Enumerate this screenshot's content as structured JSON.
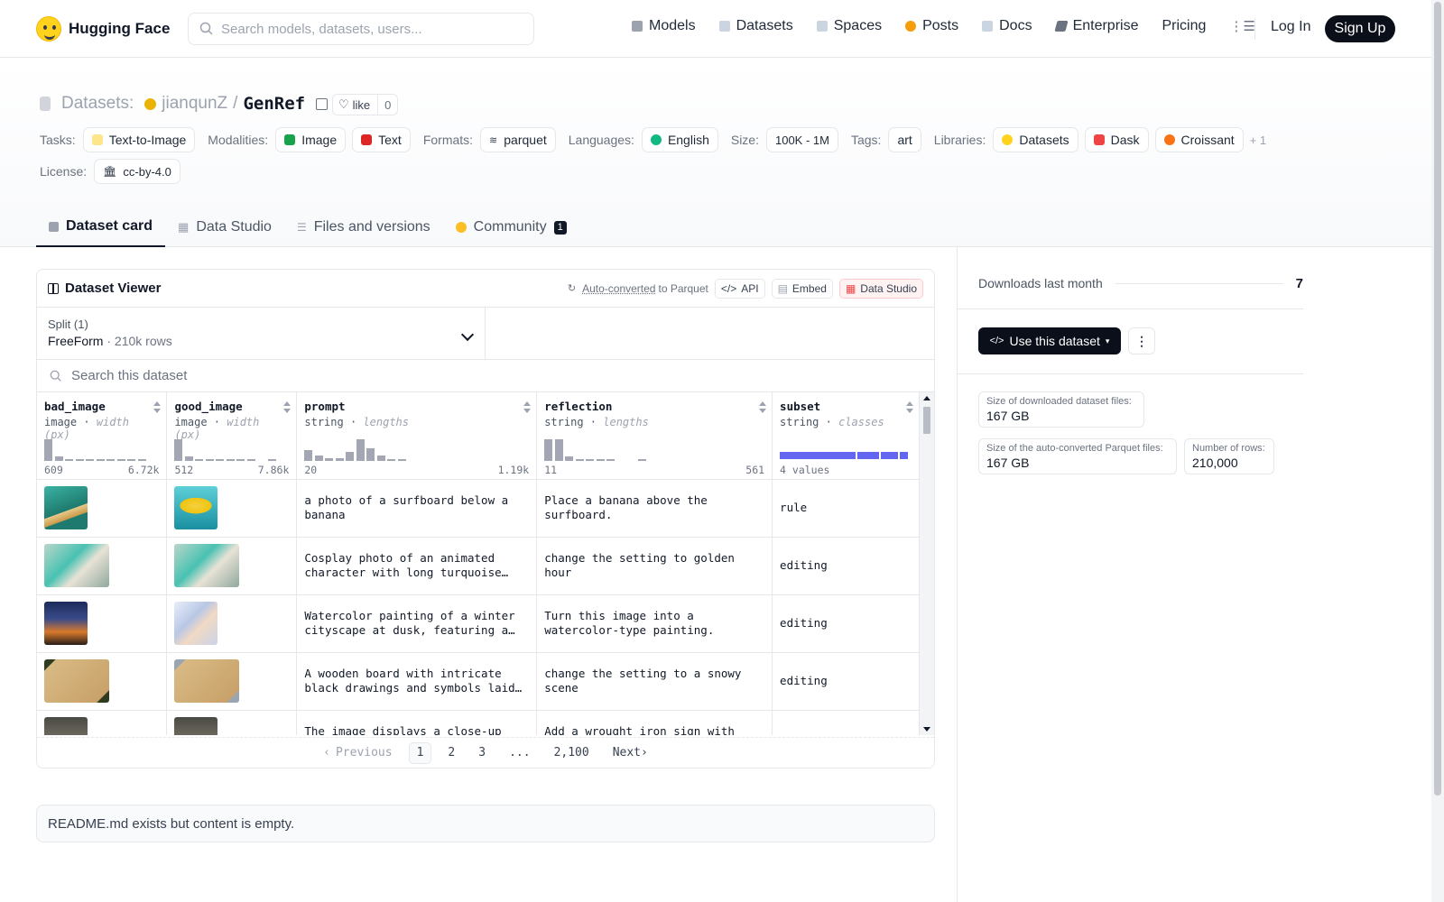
{
  "nav": {
    "logo_text": "Hugging Face",
    "search_placeholder": "Search models, datasets, users...",
    "links": [
      {
        "label": "Models",
        "color": "#6b7280"
      },
      {
        "label": "Datasets",
        "color": "#9ca3af"
      },
      {
        "label": "Spaces",
        "color": "#9ca3af"
      },
      {
        "label": "Posts",
        "color": "#f59e0b"
      },
      {
        "label": "Docs",
        "color": "#9ca3af"
      },
      {
        "label": "Enterprise",
        "color": "#6b7280"
      }
    ],
    "pricing": "Pricing",
    "login": "Log In",
    "signup": "Sign Up"
  },
  "repo": {
    "section": "Datasets:",
    "owner": "jianqunZ",
    "separator": "/",
    "name": "GenRef",
    "like_label": "like",
    "like_count": "0"
  },
  "tags": {
    "tasks_label": "Tasks:",
    "task": "Text-to-Image",
    "modalities_label": "Modalities:",
    "modalities": [
      "Image",
      "Text"
    ],
    "formats_label": "Formats:",
    "format": "parquet",
    "languages_label": "Languages:",
    "language": "English",
    "size_label": "Size:",
    "size": "100K - 1M",
    "tags_label": "Tags:",
    "tag": "art",
    "libraries_label": "Libraries:",
    "libraries": [
      "Datasets",
      "Dask",
      "Croissant"
    ],
    "libraries_more": "+ 1",
    "license_label": "License:",
    "license": "cc-by-4.0"
  },
  "tabs": [
    {
      "label": "Dataset card",
      "active": true
    },
    {
      "label": "Data Studio"
    },
    {
      "label": "Files and versions"
    },
    {
      "label": "Community",
      "badge": "1"
    }
  ],
  "viewer": {
    "title": "Dataset Viewer",
    "auto_converted": "Auto-converted",
    "to_parquet": "to Parquet",
    "api": "API",
    "embed": "Embed",
    "data_studio": "Data Studio",
    "split_label": "Split (1)",
    "split_name": "FreeForm",
    "split_rows": "210k rows",
    "search_placeholder": "Search this dataset",
    "columns": [
      {
        "name": "bad_image",
        "type": "image",
        "stat": "width (px)",
        "min": "609",
        "max": "6.72k",
        "hist": [
          0.85,
          0.15,
          0.05,
          0.05,
          0.05,
          0.05,
          0.05,
          0.05,
          0.05,
          0.05
        ]
      },
      {
        "name": "good_image",
        "type": "image",
        "stat": "width (px)",
        "min": "512",
        "max": "7.86k",
        "hist": [
          0.85,
          0.15,
          0.05,
          0.05,
          0.05,
          0.05,
          0.05,
          0.05,
          0.0,
          0.05
        ]
      },
      {
        "name": "prompt",
        "type": "string",
        "stat": "lengths",
        "min": "20",
        "max": "1.19k",
        "hist": [
          0.4,
          0.2,
          0.1,
          0.1,
          0.35,
          0.85,
          0.5,
          0.2,
          0.05,
          0.05
        ]
      },
      {
        "name": "reflection",
        "type": "string",
        "stat": "lengths",
        "min": "11",
        "max": "561",
        "hist": [
          0.85,
          0.85,
          0.15,
          0.05,
          0.05,
          0.05,
          0.05,
          0.0,
          0.0,
          0.05
        ]
      },
      {
        "name": "subset",
        "type": "string",
        "stat": "classes",
        "values_label": "4 values",
        "classes": [
          0.6,
          0.17,
          0.14,
          0.06
        ]
      }
    ],
    "rows": [
      {
        "bad": "surfboard",
        "good": "banana",
        "prompt": "a photo of a surfboard below a banana",
        "reflection": "Place a banana above the surfboard.",
        "subset": "rule"
      },
      {
        "bad": "cosplay",
        "good": "cosplay",
        "prompt": "Cosplay photo of an animated character with long turquoise hair…",
        "reflection": "change the setting to golden hour",
        "subset": "editing"
      },
      {
        "bad": "city-night",
        "good": "city-watercolor",
        "prompt": "Watercolor painting of a winter cityscape at dusk, featuring a…",
        "reflection": "Turn this image into a watercolor-type painting.",
        "subset": "editing"
      },
      {
        "bad": "board",
        "good": "board-snow",
        "prompt": "A wooden board with intricate black drawings and symbols laid flat on a…",
        "reflection": "change the setting to a snowy scene",
        "subset": "editing"
      },
      {
        "bad": "closeup",
        "good": "closeup",
        "prompt": "The image displays a close-up view…",
        "reflection": "Add a wrought iron sign with \"Au…",
        "subset": ""
      }
    ],
    "pager": {
      "prev": "Previous",
      "pages": [
        "1",
        "2",
        "3",
        "...",
        "2,100"
      ],
      "next": "Next"
    }
  },
  "readme": "README.md exists but content is empty.",
  "sidebar": {
    "downloads_label": "Downloads last month",
    "downloads_value": "7",
    "use_button": "Use this dataset",
    "size_label": "Size of downloaded dataset files:",
    "size_value": "167 GB",
    "parquet_label": "Size of the auto-converted Parquet files:",
    "parquet_value": "167 GB",
    "rows_label": "Number of rows:",
    "rows_value": "210,000"
  }
}
